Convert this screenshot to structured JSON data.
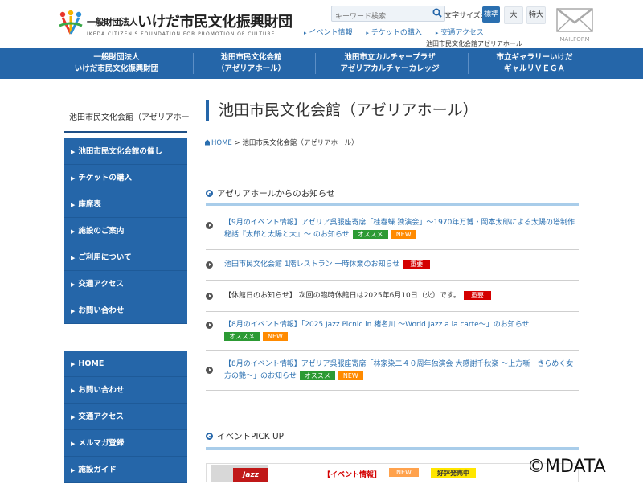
{
  "header": {
    "logo_small": "一般財団法人",
    "logo_main": "いけだ市民文化振興財団",
    "logo_sub": "IKEDA CITIZEN'S FOUNDATION FOR PROMOTION OF CULTURE",
    "search_placeholder": "キーワード検索",
    "font_size_label": "文字サイズ:",
    "font_sizes": [
      "標準",
      "大",
      "特大"
    ],
    "links": [
      "イベント情報",
      "チケットの購入",
      "交通アクセス"
    ],
    "sub_link": "池田市民文化会館アゼリアホール",
    "mail_label": "MAILFORM",
    "colors": {
      "brand": "#2566a9",
      "accent_light": "#a9cdea"
    }
  },
  "nav": [
    {
      "line1": "一般財団法人",
      "line2": "いけだ市民文化振興財団"
    },
    {
      "line1": "池田市民文化会館",
      "line2": "（アゼリアホール）"
    },
    {
      "line1": "池田市立カルチャープラザ",
      "line2": "アゼリアカルチャーカレッジ"
    },
    {
      "line1": "市立ギャラリーいけだ",
      "line2": "ギャルリＶＥＧＡ"
    }
  ],
  "page": {
    "title": "池田市民文化会館（アゼリアホール）",
    "breadcrumb_home": "HOME",
    "breadcrumb_sep": ">",
    "breadcrumb_current": "池田市民文化会館（アゼリアホール）"
  },
  "sidebar": {
    "title": "池田市民文化会館（アゼリアホー",
    "menu1": [
      "池田市民文化会館の催し",
      "チケットの購入",
      "座席表",
      "施設のご案内",
      "ご利用について",
      "交通アクセス",
      "お問い合わせ"
    ],
    "menu2": [
      "HOME",
      "お問い合わせ",
      "交通アクセス",
      "メルマガ登録",
      "施設ガイド"
    ]
  },
  "news": {
    "heading": "アゼリアホールからのお知らせ",
    "items": [
      {
        "text": "【9月のイベント情報】アゼリア呉服座寄席「桂春蝶 独演会」～1970年万博・岡本太郎による太陽の塔制作秘話『太郎と太陽と大』～ のお知らせ",
        "tags": [
          "オススメ",
          "NEW"
        ]
      },
      {
        "text": "池田市民文化会館 1階レストラン 一時休業のお知らせ",
        "tags": [
          "重要"
        ]
      },
      {
        "text": "【休館日のお知らせ】 次回の臨時休館日は2025年6月10日（火）です。",
        "tags": [
          "重要"
        ]
      },
      {
        "text": "【8月のイベント情報】「2025 Jazz Picnic in 猪名川 ～World Jazz a la carte～」のお知らせ",
        "tags": [
          "オススメ",
          "NEW"
        ]
      },
      {
        "text": "【8月のイベント情報】アゼリア呉服座寄席「林家染二４０周年独演会 大感謝千秋楽 ～上方噺一きらめく女方の艶～」のお知らせ",
        "tags": [
          "オススメ",
          "NEW"
        ]
      }
    ]
  },
  "pickup": {
    "heading": "イベントPICK UP",
    "label": "【イベント情報】",
    "new": "NEW",
    "sale": "好評発売中",
    "image_text": "Jazz"
  },
  "watermark": "©MDATA"
}
